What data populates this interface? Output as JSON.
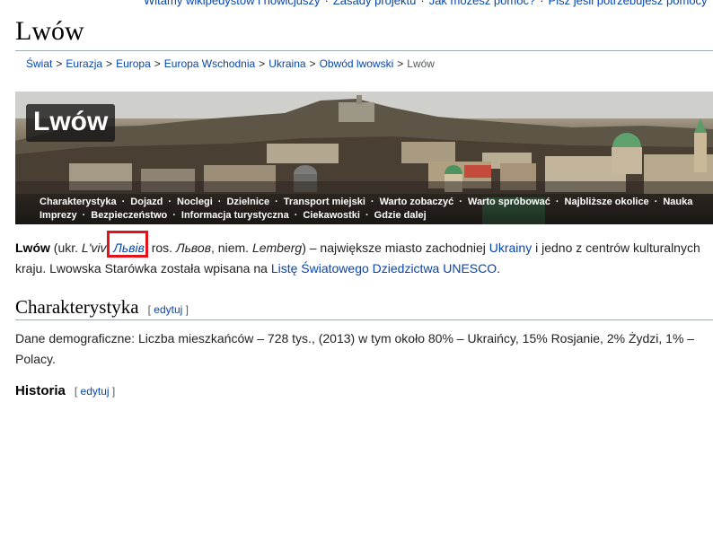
{
  "topbar": {
    "items": [
      "Witamy wikipedystów i nowicjuszy",
      "Zasady projektu",
      "Jak możesz pomóc?",
      "Pisz jeśli potrzebujesz pomocy"
    ],
    "separator": "·"
  },
  "page": {
    "title": "Lwów"
  },
  "breadcrumb": {
    "items": [
      "Świat",
      "Eurazja",
      "Europa",
      "Europa Wschodnia",
      "Ukraina",
      "Obwód lwowski"
    ],
    "current": "Lwów",
    "separator": ">"
  },
  "banner": {
    "title": "Lwów",
    "nav_row1": [
      "Charakterystyka",
      "Dojazd",
      "Noclegi",
      "Dzielnice",
      "Transport miejski",
      "Warto zobaczyć",
      "Warto spróbować",
      "Najbliższe okolice",
      "Nauka"
    ],
    "nav_row2": [
      "Imprezy",
      "Bezpieczeństwo",
      "Informacja turystyczna",
      "Ciekawostki",
      "Gdzie dalej"
    ],
    "separator": "·"
  },
  "intro": {
    "name": "Lwów",
    "ukr_prefix": " (ukr. ",
    "ukr_latin": "L'viv",
    "ukr_sep": ", ",
    "ukr_cyr": "Львів",
    "ros_prefix": ", ros. ",
    "ros": "Львов",
    "niem_prefix": ", niem. ",
    "niem": "Lemberg",
    "text1": ") – największe miasto zachodniej ",
    "link_ukraina": "Ukrainy",
    "text2": " i jedno z centrów kulturalnych",
    "line2_text": "kraju. Lwowska Starówka została wpisana na ",
    "link_unesco": "Listę Światowego Dziedzictwa UNESCO",
    "line2_end": "."
  },
  "section1": {
    "title": "Charakterystyka",
    "edit_open": "[ ",
    "edit_label": "edytuj",
    "edit_close": " ]",
    "text": "Dane demograficzne: Liczba mieszkańców – 728 tys., (2013) w tym około 80% – Ukraińcy, 15% Rosjanie, 2% Żydzi, 1% – Polacy."
  },
  "section2": {
    "title": "Historia",
    "edit_open": "[ ",
    "edit_label": "edytuj",
    "edit_close": " ]"
  }
}
